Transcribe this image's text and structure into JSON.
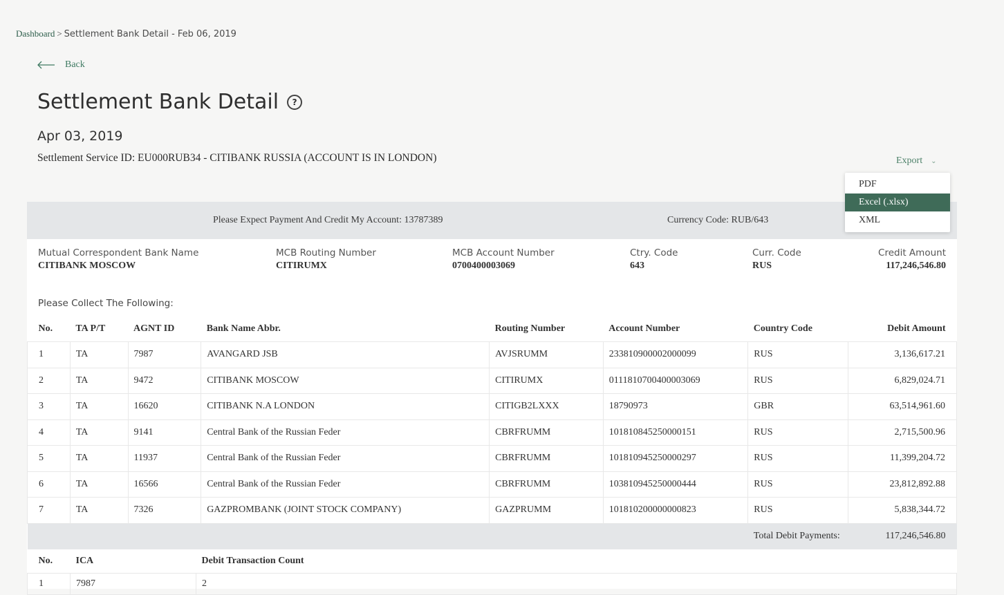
{
  "breadcrumb": {
    "root": "Dashboard",
    "separator": ">",
    "current": "Settlement Bank Detail - Feb 06, 2019"
  },
  "back_label": "Back",
  "page": {
    "title": "Settlement Bank Detail",
    "help": "?",
    "date": "Apr 03, 2019",
    "service": "Settlement Service ID: EU000RUB34 - CITIBANK RUSSIA (ACCOUNT IS IN LONDON)"
  },
  "export": {
    "label": "Export",
    "options": [
      "PDF",
      "Excel (.xlsx)",
      "XML"
    ],
    "highlighted": "Excel (.xlsx)"
  },
  "bar": {
    "expect": "Please Expect Payment And Credit My Account: 13787389",
    "currency": "Currency Code: RUB/643"
  },
  "info": {
    "mcb_name": {
      "label": "Mutual Correspondent Bank Name",
      "value": "CITIBANK MOSCOW"
    },
    "routing": {
      "label": "MCB Routing Number",
      "value": "CITIRUMX"
    },
    "account": {
      "label": "MCB Account Number",
      "value": "0700400003069"
    },
    "ctry": {
      "label": "Ctry. Code",
      "value": "643"
    },
    "curr": {
      "label": "Curr. Code",
      "value": "RUS"
    },
    "credit": {
      "label": "Credit Amount",
      "value": "117,246,546.80"
    }
  },
  "collect_label": "Please Collect The Following:",
  "table": {
    "headers": [
      "No.",
      "TA P/T",
      "AGNT ID",
      "Bank Name Abbr.",
      "Routing Number",
      "Account Number",
      "Country Code",
      "Debit Amount"
    ],
    "rows": [
      [
        "1",
        "TA",
        "7987",
        "AVANGARD JSB",
        "AVJSRUMM",
        "233810900002000099",
        "RUS",
        "3,136,617.21"
      ],
      [
        "2",
        "TA",
        "9472",
        "CITIBANK MOSCOW",
        "CITIRUMX",
        "0111810700400003069",
        "RUS",
        "6,829,024.71"
      ],
      [
        "3",
        "TA",
        "16620",
        "CITIBANK N.A LONDON",
        "CITIGB2LXXX",
        "18790973",
        "GBR",
        "63,514,961.60"
      ],
      [
        "4",
        "TA",
        "9141",
        "Central Bank of the Russian Feder",
        "CBRFRUMM",
        "101810845250000151",
        "RUS",
        "2,715,500.96"
      ],
      [
        "5",
        "TA",
        "11937",
        "Central Bank of the Russian Feder",
        "CBRFRUMM",
        "101810945250000297",
        "RUS",
        "11,399,204.72"
      ],
      [
        "6",
        "TA",
        "16566",
        "Central Bank of the Russian Feder",
        "CBRFRUMM",
        "103810945250000444",
        "RUS",
        "23,812,892.88"
      ],
      [
        "7",
        "TA",
        "7326",
        "GAZPROMBANK (JOINT STOCK COMPANY)",
        "GAZPRUMM",
        "101810200000000823",
        "RUS",
        "5,838,344.72"
      ]
    ],
    "total_label": "Total Debit Payments:",
    "total_value": "117,246,546.80"
  },
  "ica_table": {
    "headers": [
      "No.",
      "ICA",
      "Debit Transaction Count"
    ],
    "rows": [
      [
        "1",
        "7987",
        "2"
      ]
    ]
  }
}
